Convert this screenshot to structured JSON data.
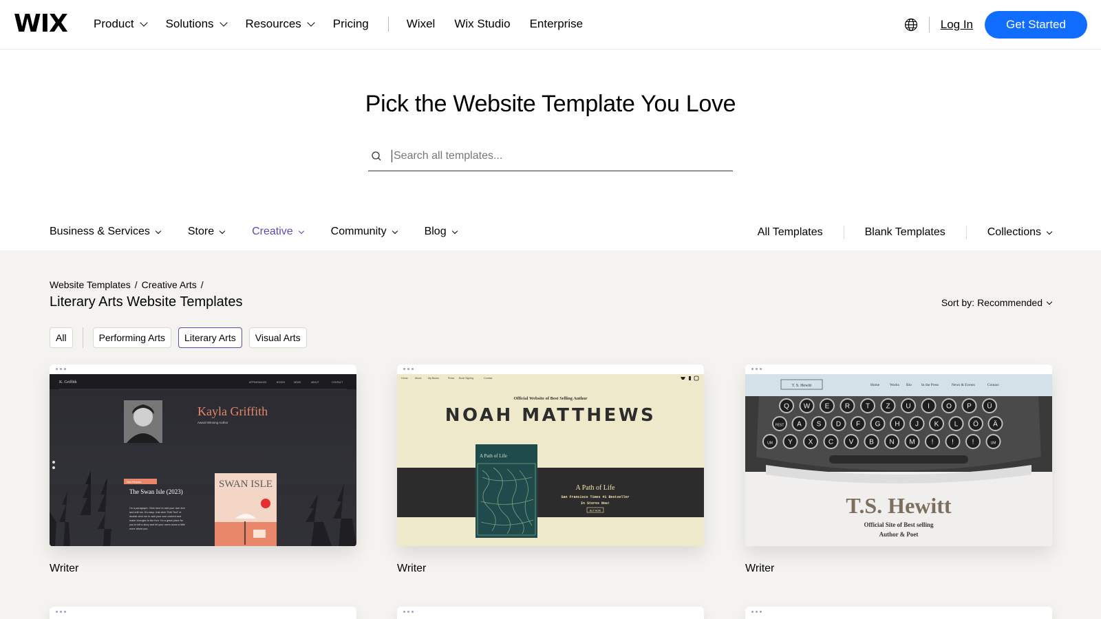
{
  "nav": {
    "logo": "WIX",
    "menus": [
      {
        "label": "Product",
        "has_dropdown": true
      },
      {
        "label": "Solutions",
        "has_dropdown": true
      },
      {
        "label": "Resources",
        "has_dropdown": true
      },
      {
        "label": "Pricing",
        "has_dropdown": false
      }
    ],
    "links": [
      "Wixel",
      "Wix Studio",
      "Enterprise"
    ],
    "language_icon": "globe-icon",
    "login": "Log In",
    "cta": "Get Started",
    "cta_color": "#116dff"
  },
  "hero": {
    "title": "Pick the Website Template You Love",
    "search_placeholder": "Search all templates..."
  },
  "categories": {
    "items": [
      {
        "label": "Business & Services",
        "active": false
      },
      {
        "label": "Store",
        "active": false
      },
      {
        "label": "Creative",
        "active": true
      },
      {
        "label": "Community",
        "active": false
      },
      {
        "label": "Blog",
        "active": false
      }
    ],
    "right": [
      "All Templates",
      "Blank Templates",
      "Collections"
    ],
    "active_color": "#5a4bb5"
  },
  "breadcrumb": [
    "Website Templates",
    "Creative Arts"
  ],
  "page_title": "Literary Arts Website Templates",
  "sort": {
    "label": "Sort by:",
    "value": "Recommended"
  },
  "filters": [
    {
      "label": "All",
      "selected": false
    },
    {
      "label": "Performing Arts",
      "selected": false
    },
    {
      "label": "Literary Arts",
      "selected": true
    },
    {
      "label": "Visual Arts",
      "selected": false
    }
  ],
  "templates": [
    {
      "name": "Writer",
      "preview": {
        "brand": "K. Griffith",
        "nav": [
          "APPEARANCES",
          "BOOKS",
          "NEWS",
          "ABOUT",
          "CONTACT"
        ],
        "title": "Kayla Griffith",
        "subtitle": "Award Winning Author",
        "badge": "New Release",
        "book_heading": "The Swan Isle (2023)",
        "body": "I'm a paragraph. Click here to add your own text and edit me. It's easy. Just click \"Edit Text\" or double click me to add your own content and make changes to the font. I'm a great place for you to tell a story and let your users know a little more about you.",
        "cover_title": "SWAN ISLE"
      }
    },
    {
      "name": "Writer",
      "preview": {
        "nav": [
          "Home",
          "About",
          "My Books",
          "Press",
          "Book Signing",
          "Contact"
        ],
        "kicker": "Official Website of Best Selling Author",
        "title": "NOAH MATTHEWS",
        "cover_title": "A Path of Life",
        "book_title": "A Path of Life",
        "tagline": "San Francisco Times #1 Bestseller",
        "tagline2": "In Stores Now!",
        "button": "BUY NOW"
      }
    },
    {
      "name": "Writer",
      "preview": {
        "brand": "T. S. Hewitt",
        "nav": [
          "Home",
          "Works",
          "Bio",
          "In the Press",
          "News & Events",
          "Contact"
        ],
        "title": "T.S. Hewitt",
        "subtitle1": "Official Site of Best selling",
        "subtitle2": "Author & Poet",
        "keys_row1": [
          "Q",
          "W",
          "E",
          "R",
          "T",
          "Z",
          "U",
          "I",
          "O",
          "P",
          "Ü"
        ],
        "keys_row2": [
          "FEST",
          "A",
          "S",
          "D",
          "F",
          "G",
          "H",
          "J",
          "K",
          "L",
          "Ö",
          "Ä"
        ],
        "keys_row3": [
          "UM",
          "Y",
          "X",
          "C",
          "V",
          "B",
          "N",
          "M",
          "!",
          "!",
          "!",
          "UM"
        ]
      }
    }
  ]
}
